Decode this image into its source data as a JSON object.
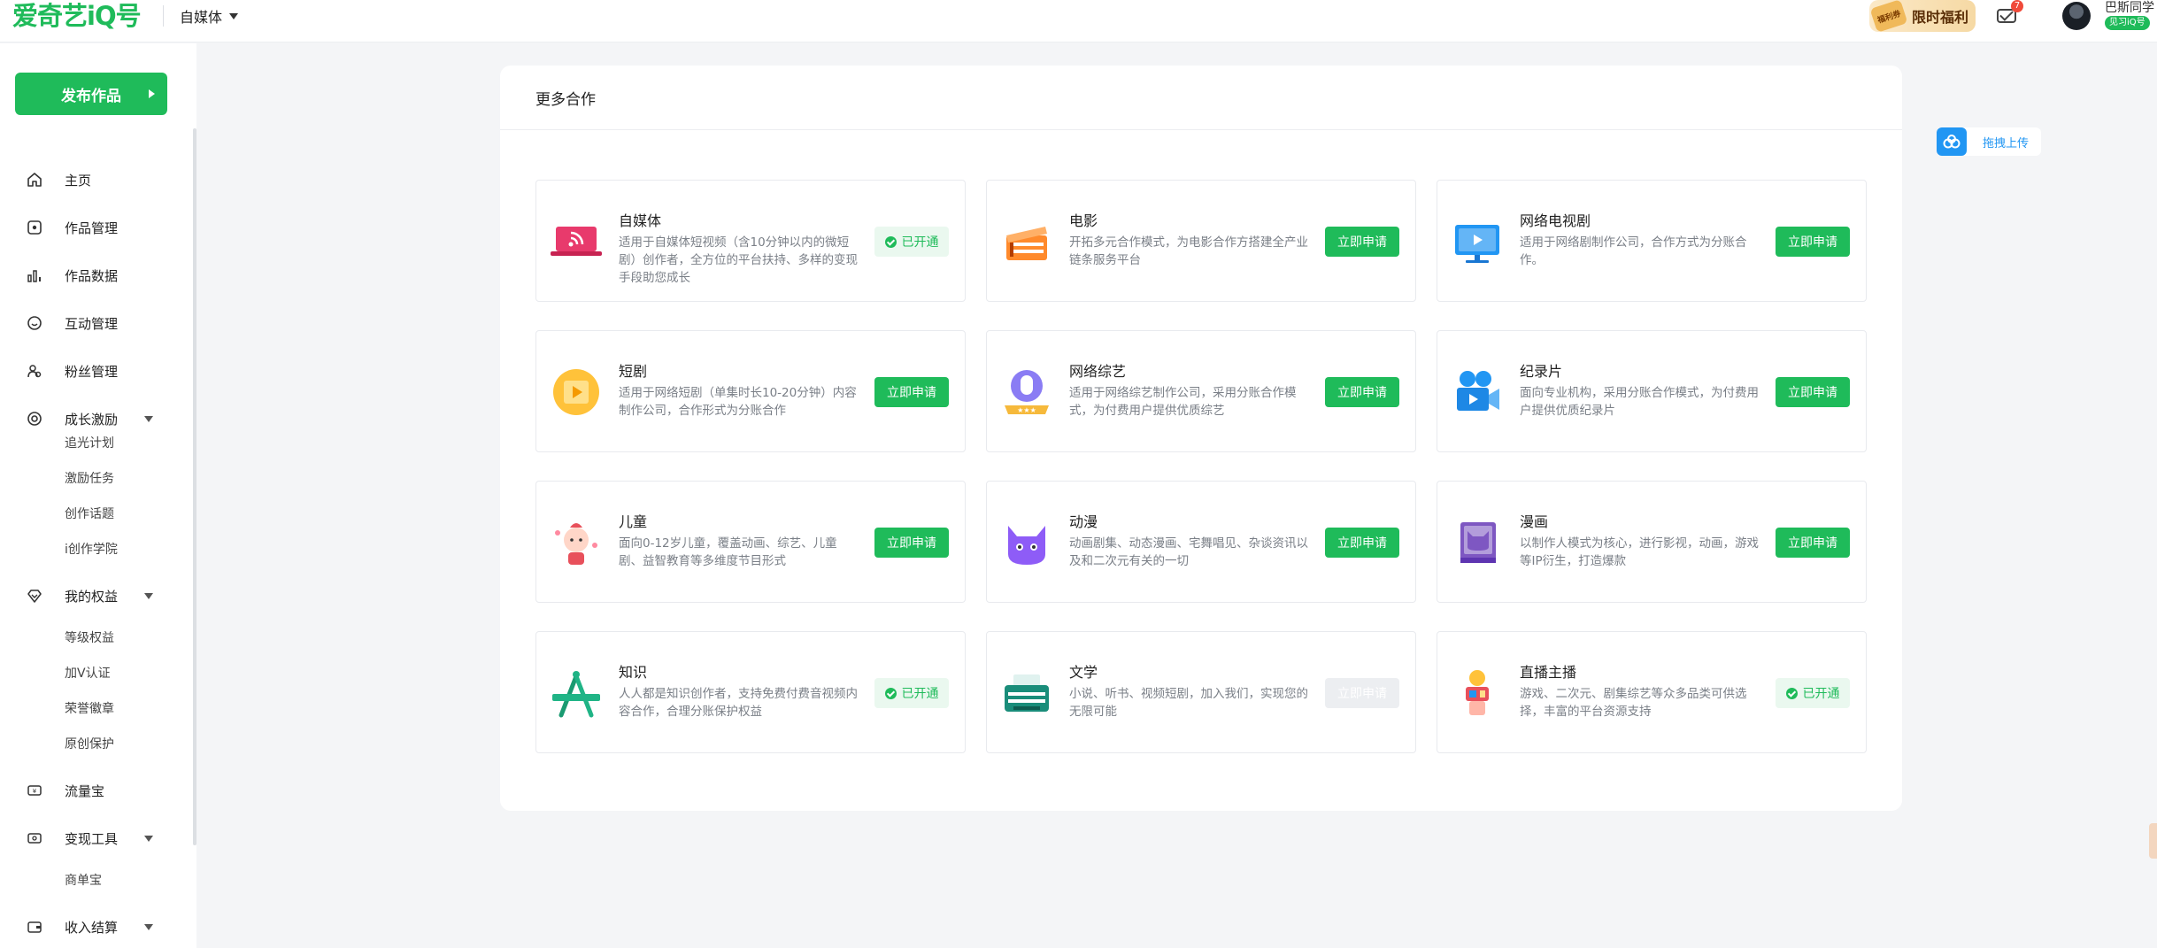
{
  "header": {
    "logo_text": "爱奇艺iQ号",
    "role_label": "自媒体",
    "promo_badge": "福利券",
    "promo_label": "限时福利",
    "mail_count": "7",
    "username": "巴斯同学",
    "user_badge": "见习iQ号"
  },
  "sidebar": {
    "publish_label": "发布作品",
    "items": [
      {
        "label": "主页"
      },
      {
        "label": "作品管理"
      },
      {
        "label": "作品数据"
      },
      {
        "label": "互动管理"
      },
      {
        "label": "粉丝管理"
      },
      {
        "label": "成长激励",
        "children": [
          "追光计划",
          "激励任务",
          "创作话题",
          "i创作学院"
        ]
      },
      {
        "label": "我的权益",
        "children": [
          "等级权益",
          "加V认证",
          "荣誉徽章",
          "原创保护"
        ]
      },
      {
        "label": "流量宝"
      },
      {
        "label": "变现工具",
        "children": [
          "商单宝"
        ]
      },
      {
        "label": "收入结算"
      }
    ]
  },
  "main": {
    "section_title": "更多合作",
    "tiles": [
      {
        "title": "自媒体",
        "desc": "适用于自媒体短视频（含10分钟以内的微短剧）创作者，全方位的平台扶持、多样的变现手段助您成长",
        "action": "已开通",
        "state": "open"
      },
      {
        "title": "电影",
        "desc": "开拓多元合作模式，为电影合作方搭建全产业链条服务平台",
        "action": "立即申请",
        "state": "apply"
      },
      {
        "title": "网络电视剧",
        "desc": "适用于网络剧制作公司，合作方式为分账合作。",
        "action": "立即申请",
        "state": "apply"
      },
      {
        "title": "短剧",
        "desc": "适用于网络短剧（单集时长10-20分钟）内容制作公司，合作形式为分账合作",
        "action": "立即申请",
        "state": "apply"
      },
      {
        "title": "网络综艺",
        "desc": "适用于网络综艺制作公司，采用分账合作模式，为付费用户提供优质综艺",
        "action": "立即申请",
        "state": "apply"
      },
      {
        "title": "纪录片",
        "desc": "面向专业机构，采用分账合作模式，为付费用户提供优质纪录片",
        "action": "立即申请",
        "state": "apply"
      },
      {
        "title": "儿童",
        "desc": "面向0-12岁儿童，覆盖动画、综艺、儿童剧、益智教育等多维度节目形式",
        "action": "立即申请",
        "state": "apply"
      },
      {
        "title": "动漫",
        "desc": "动画剧集、动态漫画、宅舞唱见、杂谈资讯以及和二次元有关的一切",
        "action": "立即申请",
        "state": "apply"
      },
      {
        "title": "漫画",
        "desc": "以制作人模式为核心，进行影视，动画，游戏等IP衍生，打造爆款",
        "action": "立即申请",
        "state": "apply"
      },
      {
        "title": "知识",
        "desc": "人人都是知识创作者，支持免费付费音视频内容合作，合理分账保护权益",
        "action": "已开通",
        "state": "open"
      },
      {
        "title": "文学",
        "desc": "小说、听书、视频短剧，加入我们，实现您的无限可能",
        "action": "立即申请",
        "state": "disabled"
      },
      {
        "title": "直播主播",
        "desc": "游戏、二次元、剧集综艺等众多品类可供选择，丰富的平台资源支持",
        "action": "已开通",
        "state": "open"
      }
    ]
  },
  "float": {
    "upload_label": "拖拽上传"
  },
  "colors": {
    "brand_green": "#1fbb5a",
    "upload_blue": "#2196f3",
    "page_bg": "#f4f5f7"
  }
}
